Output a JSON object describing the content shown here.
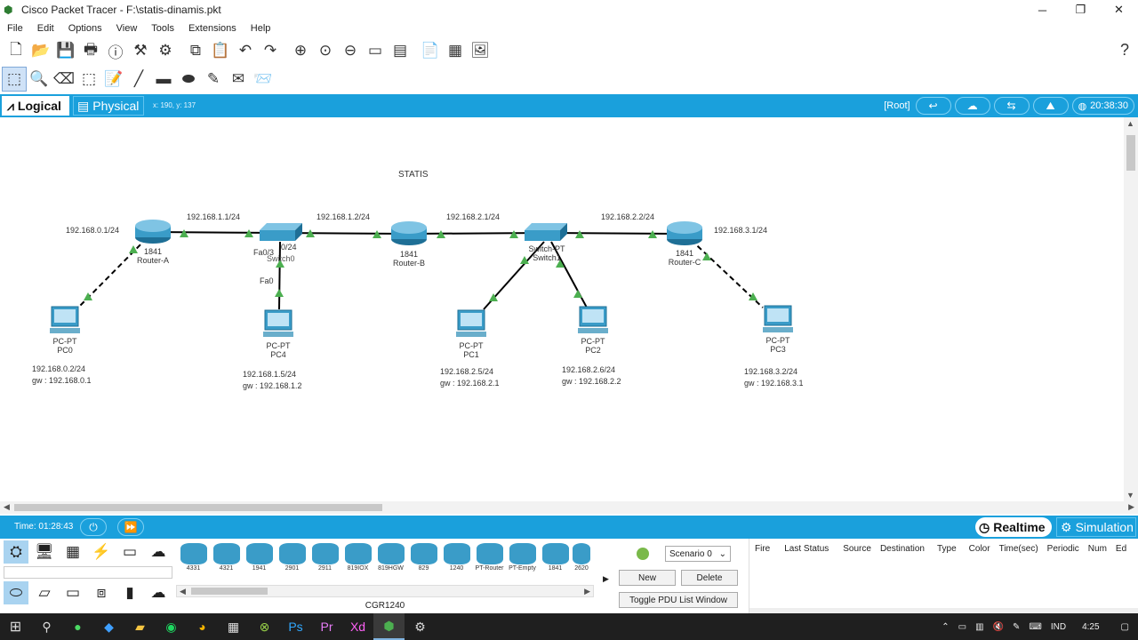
{
  "window": {
    "title": "Cisco Packet Tracer - F:\\statis-dinamis.pkt",
    "controls": {
      "minimize": "─",
      "maximize": "❐",
      "close": "✕"
    }
  },
  "menu": [
    "File",
    "Edit",
    "Options",
    "View",
    "Tools",
    "Extensions",
    "Help"
  ],
  "viewbar": {
    "logical": "Logical",
    "physical": "Physical",
    "coords": "x: 190, y: 137",
    "root": "[Root]",
    "clock": "20:38:30"
  },
  "canvas": {
    "title": "STATIS",
    "devices": {
      "router_a": {
        "model": "1841",
        "name": "Router-A"
      },
      "router_b": {
        "model": "1841",
        "name": "Router-B"
      },
      "router_c": {
        "model": "1841",
        "name": "Router-C"
      },
      "switch0": {
        "name": "Switch0",
        "port_a": "Fa0/3",
        "port_b": "0/24"
      },
      "switch1": {
        "type": "Switch-PT",
        "name": "Switch1"
      },
      "pc0": {
        "type": "PC-PT",
        "name": "PC0",
        "ip": "192.168.0.2/24",
        "gw": "gw : 192.168.0.1"
      },
      "pc4": {
        "type": "PC-PT",
        "name": "PC4",
        "ip": "192.168.1.5/24",
        "gw": "gw : 192.168.1.2",
        "port": "Fa0"
      },
      "pc1": {
        "type": "PC-PT",
        "name": "PC1",
        "ip": "192.168.2.5/24",
        "gw": "gw : 192.168.2.1"
      },
      "pc2": {
        "type": "PC-PT",
        "name": "PC2",
        "ip": "192.168.2.6/24",
        "gw": "gw : 192.168.2.2"
      },
      "pc3": {
        "type": "PC-PT",
        "name": "PC3",
        "ip": "192.168.3.2/24",
        "gw": "gw : 192.168.3.1"
      }
    },
    "networks": {
      "net0": "192.168.0.1/24",
      "net1a": "192.168.1.1/24",
      "net1b": "192.168.1.2/24",
      "net2a": "192.168.2.1/24",
      "net2b": "192.168.2.2/24",
      "net3": "192.168.3.1/24"
    }
  },
  "timebar": {
    "time": "Time: 01:28:43",
    "realtime": "Realtime",
    "simulation": "Simulation"
  },
  "device_models": [
    "4331",
    "4321",
    "1941",
    "2901",
    "2911",
    "819IOX",
    "819HGW",
    "829",
    "1240",
    "PT-Router",
    "PT-Empty",
    "1841",
    "2620"
  ],
  "selected_model": "CGR1240",
  "pdu": {
    "scenario": "Scenario 0",
    "new": "New",
    "delete": "Delete",
    "toggle": "Toggle PDU List Window"
  },
  "event_columns": [
    "Fire",
    "Last Status",
    "Source",
    "Destination",
    "Type",
    "Color",
    "Time(sec)",
    "Periodic",
    "Num",
    "Ed"
  ],
  "taskbar": {
    "lang": "IND",
    "clock": "4:25"
  },
  "colors": {
    "accent": "#1aa0dc",
    "link_up": "#4caf50"
  }
}
